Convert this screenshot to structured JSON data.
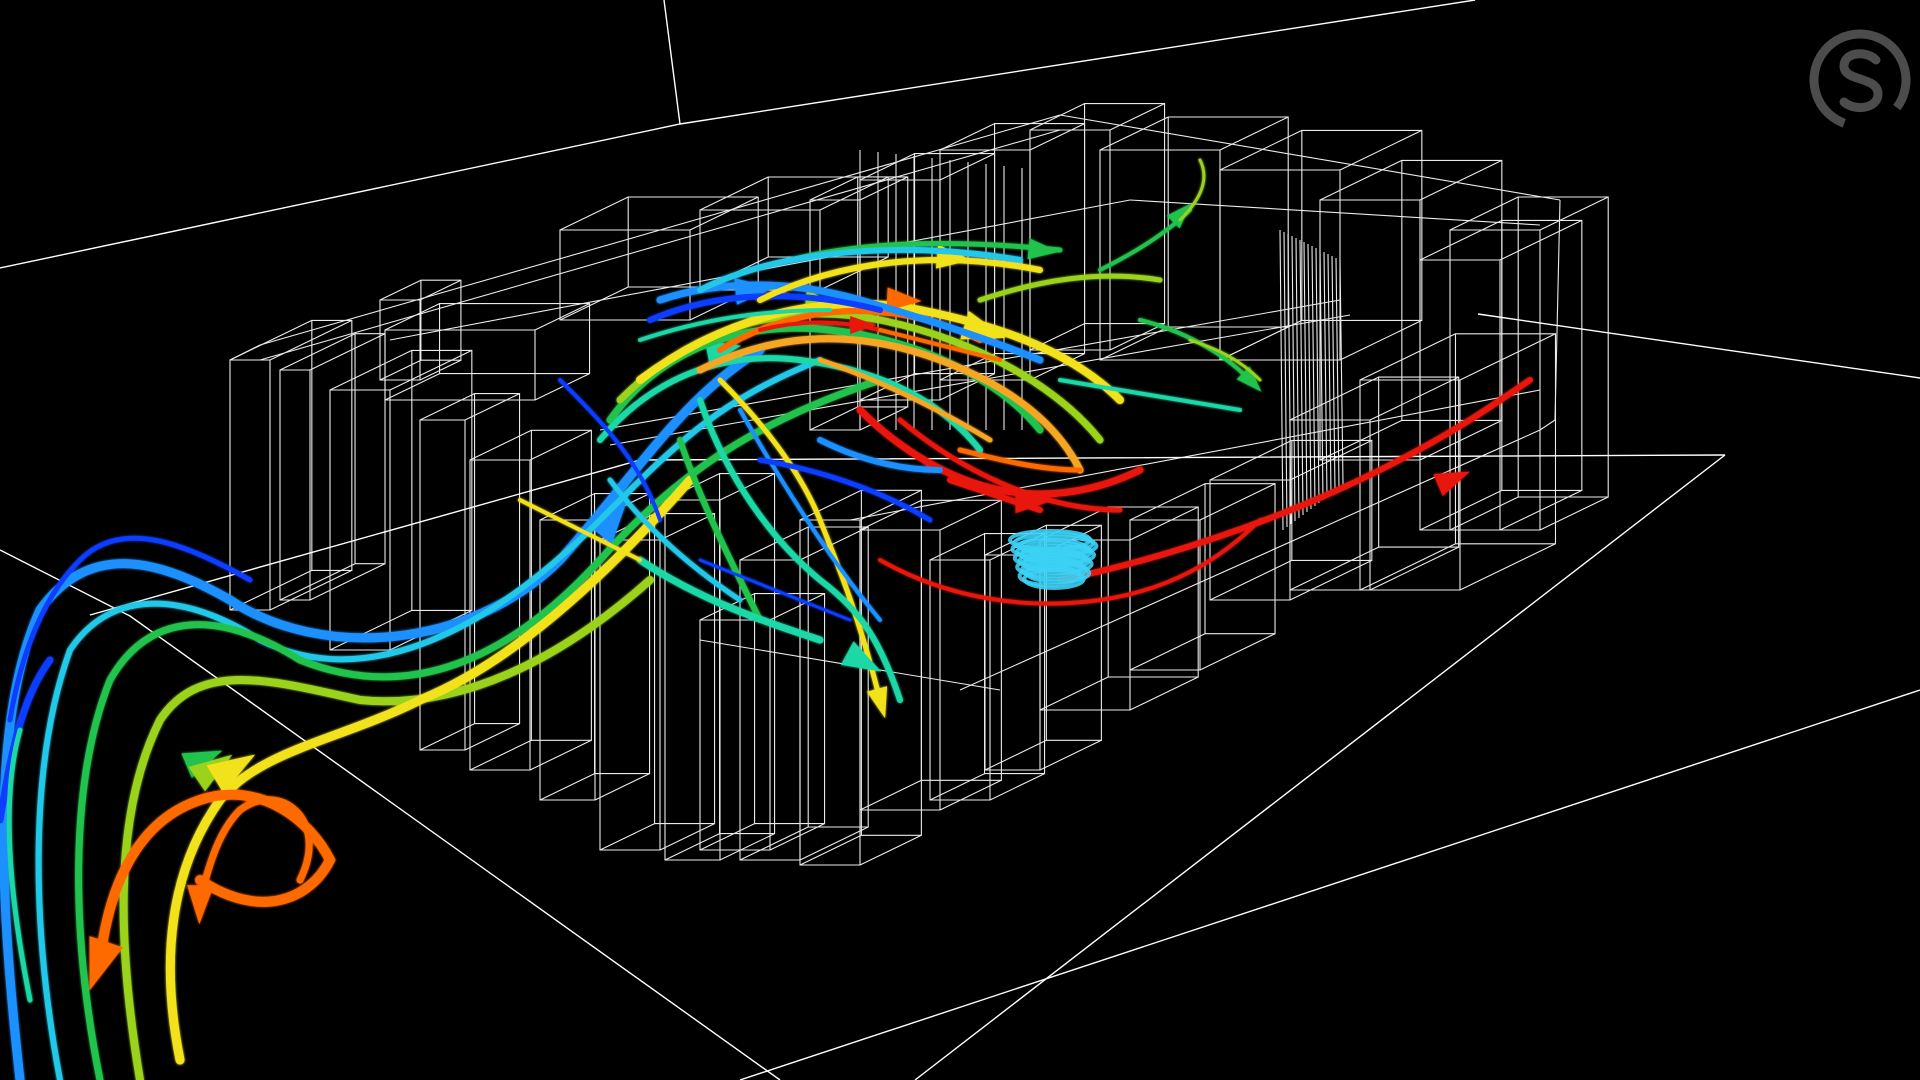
{
  "scene": {
    "background": "#000000",
    "wireframe_color": "#ffffff",
    "streamline_palette": [
      "#0a3cff",
      "#1e90ff",
      "#21c8e8",
      "#1fd7a6",
      "#23c34d",
      "#9ad21f",
      "#f2e21b",
      "#f5a623",
      "#ff6a00",
      "#e8190c"
    ],
    "vortex_color": "#3cd2f5"
  },
  "logo": {
    "icon": "circular-s-logo-icon",
    "color": "#8a8a8a"
  }
}
